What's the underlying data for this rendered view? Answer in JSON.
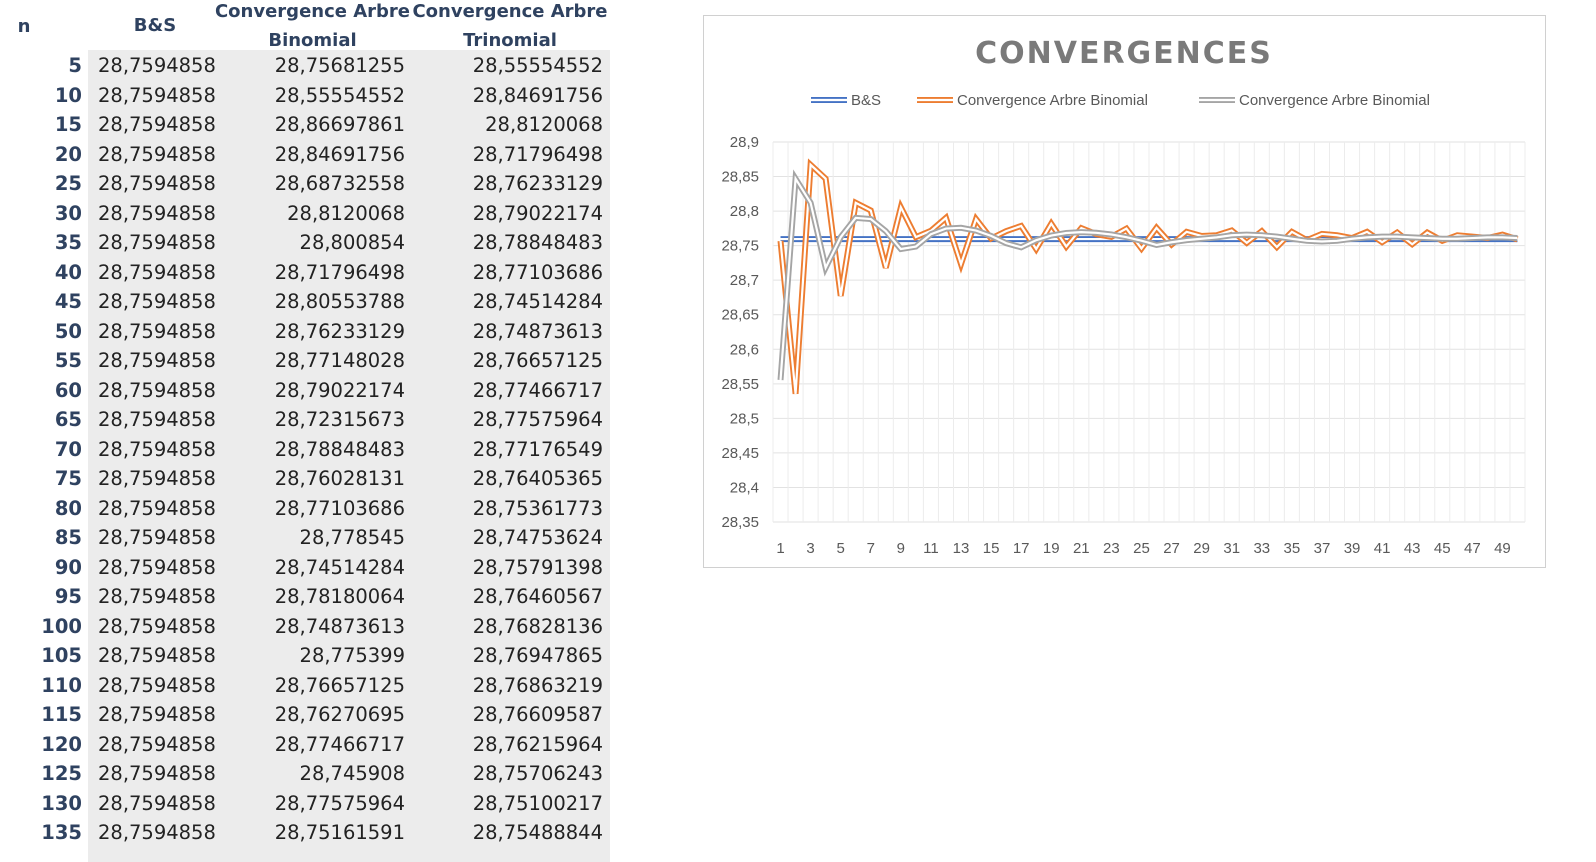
{
  "table": {
    "headers": {
      "n": "n",
      "bs": "B&S",
      "binomial_line1": "Convergence Arbre",
      "binomial_line2": "Binomial",
      "trinomial_line1": "Convergence Arbre",
      "trinomial_line2": "Trinomial"
    },
    "rows": [
      {
        "n": "5",
        "bs": "28,7594858",
        "binomial": "28,75681255",
        "trinomial": "28,55554552"
      },
      {
        "n": "10",
        "bs": "28,7594858",
        "binomial": "28,55554552",
        "trinomial": "28,84691756"
      },
      {
        "n": "15",
        "bs": "28,7594858",
        "binomial": "28,86697861",
        "trinomial": "28,8120068"
      },
      {
        "n": "20",
        "bs": "28,7594858",
        "binomial": "28,84691756",
        "trinomial": "28,71796498"
      },
      {
        "n": "25",
        "bs": "28,7594858",
        "binomial": "28,68732558",
        "trinomial": "28,76233129"
      },
      {
        "n": "30",
        "bs": "28,7594858",
        "binomial": "28,8120068",
        "trinomial": "28,79022174"
      },
      {
        "n": "35",
        "bs": "28,7594858",
        "binomial": "28,800854",
        "trinomial": "28,78848483"
      },
      {
        "n": "40",
        "bs": "28,7594858",
        "binomial": "28,71796498",
        "trinomial": "28,77103686"
      },
      {
        "n": "45",
        "bs": "28,7594858",
        "binomial": "28,80553788",
        "trinomial": "28,74514284"
      },
      {
        "n": "50",
        "bs": "28,7594858",
        "binomial": "28,76233129",
        "trinomial": "28,74873613"
      },
      {
        "n": "55",
        "bs": "28,7594858",
        "binomial": "28,77148028",
        "trinomial": "28,76657125"
      },
      {
        "n": "60",
        "bs": "28,7594858",
        "binomial": "28,79022174",
        "trinomial": "28,77466717"
      },
      {
        "n": "65",
        "bs": "28,7594858",
        "binomial": "28,72315673",
        "trinomial": "28,77575964"
      },
      {
        "n": "70",
        "bs": "28,7594858",
        "binomial": "28,78848483",
        "trinomial": "28,77176549"
      },
      {
        "n": "75",
        "bs": "28,7594858",
        "binomial": "28,76028131",
        "trinomial": "28,76405365"
      },
      {
        "n": "80",
        "bs": "28,7594858",
        "binomial": "28,77103686",
        "trinomial": "28,75361773"
      },
      {
        "n": "85",
        "bs": "28,7594858",
        "binomial": "28,778545",
        "trinomial": "28,74753624"
      },
      {
        "n": "90",
        "bs": "28,7594858",
        "binomial": "28,74514284",
        "trinomial": "28,75791398"
      },
      {
        "n": "95",
        "bs": "28,7594858",
        "binomial": "28,78180064",
        "trinomial": "28,76460567"
      },
      {
        "n": "100",
        "bs": "28,7594858",
        "binomial": "28,74873613",
        "trinomial": "28,76828136"
      },
      {
        "n": "105",
        "bs": "28,7594858",
        "binomial": "28,775399",
        "trinomial": "28,76947865"
      },
      {
        "n": "110",
        "bs": "28,7594858",
        "binomial": "28,76657125",
        "trinomial": "28,76863219"
      },
      {
        "n": "115",
        "bs": "28,7594858",
        "binomial": "28,76270695",
        "trinomial": "28,76609587"
      },
      {
        "n": "120",
        "bs": "28,7594858",
        "binomial": "28,77466717",
        "trinomial": "28,76215964"
      },
      {
        "n": "125",
        "bs": "28,7594858",
        "binomial": "28,745908",
        "trinomial": "28,75706243"
      },
      {
        "n": "130",
        "bs": "28,7594858",
        "binomial": "28,77575964",
        "trinomial": "28,75100217"
      },
      {
        "n": "135",
        "bs": "28,7594858",
        "binomial": "28,75161591",
        "trinomial": "28,75488844"
      }
    ]
  },
  "chart_data": {
    "type": "line",
    "title": "CONVERGENCES",
    "legend_position": "top",
    "grid": true,
    "ylim": [
      28.35,
      28.9
    ],
    "y_ticks": [
      "28,9",
      "28,85",
      "28,8",
      "28,75",
      "28,7",
      "28,65",
      "28,6",
      "28,55",
      "28,5",
      "28,45",
      "28,4",
      "28,35"
    ],
    "y_tick_values": [
      28.9,
      28.85,
      28.8,
      28.75,
      28.7,
      28.65,
      28.6,
      28.55,
      28.5,
      28.45,
      28.4,
      28.35
    ],
    "x": [
      1,
      2,
      3,
      4,
      5,
      6,
      7,
      8,
      9,
      10,
      11,
      12,
      13,
      14,
      15,
      16,
      17,
      18,
      19,
      20,
      21,
      22,
      23,
      24,
      25,
      26,
      27,
      28,
      29,
      30,
      31,
      32,
      33,
      34,
      35,
      36,
      37,
      38,
      39,
      40,
      41,
      42,
      43,
      44,
      45,
      46,
      47,
      48,
      49,
      50
    ],
    "x_ticks": [
      "1",
      "3",
      "5",
      "7",
      "9",
      "11",
      "13",
      "15",
      "17",
      "19",
      "21",
      "23",
      "25",
      "27",
      "29",
      "31",
      "33",
      "35",
      "37",
      "39",
      "41",
      "43",
      "45",
      "47",
      "49"
    ],
    "series": [
      {
        "name": "B&S",
        "color": "#4472c4",
        "values": [
          28.7595,
          28.7595,
          28.7595,
          28.7595,
          28.7595,
          28.7595,
          28.7595,
          28.7595,
          28.7595,
          28.7595,
          28.7595,
          28.7595,
          28.7595,
          28.7595,
          28.7595,
          28.7595,
          28.7595,
          28.7595,
          28.7595,
          28.7595,
          28.7595,
          28.7595,
          28.7595,
          28.7595,
          28.7595,
          28.7595,
          28.7595,
          28.7595,
          28.7595,
          28.7595,
          28.7595,
          28.7595,
          28.7595,
          28.7595,
          28.7595,
          28.7595,
          28.7595,
          28.7595,
          28.7595,
          28.7595,
          28.7595,
          28.7595,
          28.7595,
          28.7595,
          28.7595,
          28.7595,
          28.7595,
          28.7595,
          28.7595,
          28.7595
        ]
      },
      {
        "name": "Convergence Arbre Binomial",
        "color": "#ed7d31",
        "values": [
          28.7568,
          28.5355,
          28.867,
          28.8469,
          28.6773,
          28.812,
          28.8009,
          28.718,
          28.8055,
          28.7623,
          28.7715,
          28.7902,
          28.7232,
          28.7885,
          28.7603,
          28.771,
          28.7785,
          28.7451,
          28.7818,
          28.7487,
          28.7754,
          28.7666,
          28.7627,
          28.7747,
          28.7459,
          28.7758,
          28.7516,
          28.77,
          28.764,
          28.765,
          28.772,
          28.754,
          28.771,
          28.748,
          28.77,
          28.758,
          28.767,
          28.765,
          28.761,
          28.77,
          28.755,
          28.769,
          28.752,
          28.769,
          28.757,
          28.765,
          28.763,
          28.761,
          28.766,
          28.759
        ]
      },
      {
        "name": "Convergence Arbre Binomial",
        "color": "#a5a5a5",
        "values": [
          28.5555,
          28.8469,
          28.812,
          28.718,
          28.7623,
          28.7902,
          28.7885,
          28.771,
          28.7451,
          28.7487,
          28.7666,
          28.7747,
          28.7758,
          28.7718,
          28.7641,
          28.7536,
          28.7475,
          28.7579,
          28.7646,
          28.7683,
          28.7695,
          28.7686,
          28.7661,
          28.7622,
          28.7571,
          28.751,
          28.7549,
          28.758,
          28.76,
          28.762,
          28.765,
          28.766,
          28.765,
          28.763,
          28.76,
          28.757,
          28.756,
          28.757,
          28.76,
          28.762,
          28.763,
          28.763,
          28.762,
          28.761,
          28.76,
          28.76,
          28.761,
          28.762,
          28.762,
          28.761
        ]
      }
    ]
  }
}
